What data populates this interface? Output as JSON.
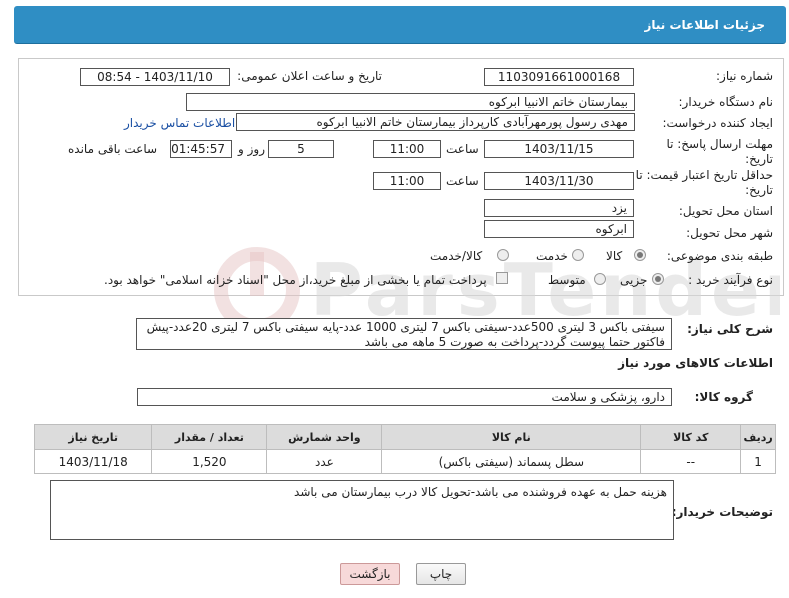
{
  "header": {
    "title": "جزئیات اطلاعات نیاز"
  },
  "fields": {
    "need_number": {
      "label": "شماره نیاز:",
      "value": "1103091661000168"
    },
    "announce_datetime": {
      "label": "تاریخ و ساعت اعلان عمومی:",
      "value": "1403/11/10 - 08:54"
    },
    "buyer_org": {
      "label": "نام دستگاه خریدار:",
      "value": "بیمارستان خاتم الانبیا ابرکوه"
    },
    "requester": {
      "label": "ایجاد کننده درخواست:",
      "value": "مهدی رسول پورمهرآبادی کارپرداز بیمارستان خاتم الانبیا ابرکوه",
      "contact_link": "اطلاعات تماس خریدار"
    },
    "reply_deadline": {
      "label": "مهلت ارسال پاسخ: تا",
      "label2": "تاریخ:",
      "date": "1403/11/15",
      "time_label": "ساعت",
      "time": "11:00",
      "days": "5",
      "days_label": "روز و",
      "remaining": "01:45:57",
      "remaining_label": "ساعت باقی مانده"
    },
    "price_validity": {
      "label": "حداقل تاریخ اعتبار قیمت: تا",
      "label2": "تاریخ:",
      "date": "1403/11/30",
      "time_label": "ساعت",
      "time": "11:00"
    },
    "province": {
      "label": "استان محل تحویل:",
      "value": "یزد"
    },
    "city": {
      "label": "شهر محل تحویل:",
      "value": "ابرکوه"
    },
    "category": {
      "label": "طبقه بندی موضوعی:",
      "options": [
        "کالا",
        "خدمت",
        "کالا/خدمت"
      ],
      "selected": "کالا"
    },
    "process": {
      "label": "نوع فرآیند خرید :",
      "options": [
        "جزیی",
        "متوسط"
      ],
      "selected": "جزیی",
      "note": "پرداخت تمام یا بخشی از مبلغ خرید،از محل \"اسناد خزانه اسلامی\" خواهد بود."
    }
  },
  "description": {
    "label": "شرح کلی نیاز:",
    "text": "سیفتی باکس 3 لیتری 500عدد-سیفتی باکس 7 لیتری 1000 عدد-پایه سیفتی باکس 7 لیتری 20عدد-پیش فاکتور حتما پیوست گردد-پرداخت به صورت 5 ماهه می باشد"
  },
  "goods_section": {
    "title": "اطلاعات کالاهای مورد نیاز"
  },
  "goods_group": {
    "label": "گروه کالا:",
    "value": "دارو، پزشکی و سلامت"
  },
  "table": {
    "headers": [
      "ردیف",
      "کد کالا",
      "نام کالا",
      "واحد شمارش",
      "تعداد / مقدار",
      "تاریخ نیاز"
    ],
    "rows": [
      [
        "1",
        "--",
        "سطل پسماند (سیفتی باکس)",
        "عدد",
        "1,520",
        "1403/11/18"
      ]
    ]
  },
  "buyer_notes": {
    "label": "توضیحات خریدار:",
    "text": "هزینه حمل به عهده فروشنده می باشد-تحویل کالا درب بیمارستان می باشد"
  },
  "buttons": {
    "print": "چاپ",
    "back": "بازگشت"
  },
  "watermark": {
    "text": "ParsTenderNet"
  }
}
